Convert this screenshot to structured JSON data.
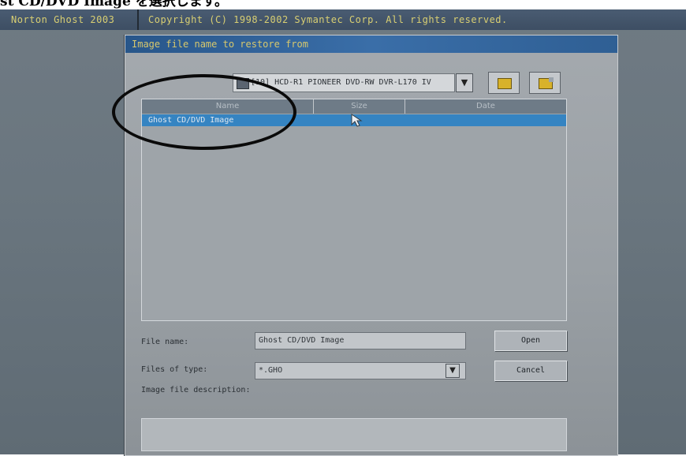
{
  "caption": "st CD/DVD Image を選択します。",
  "ghost": {
    "product": "Norton Ghost 2003",
    "copyright": "Copyright (C) 1998-2002 Symantec Corp. All rights reserved."
  },
  "dialog": {
    "title": "Image file name to restore from",
    "drive": "[10] HCD-R1 PIONEER DVD-RW DVR-L170 IV",
    "columns": [
      "Name",
      "Size",
      "Date"
    ],
    "rows": [
      {
        "name": "Ghost CD/DVD Image",
        "size": "",
        "date": ""
      }
    ],
    "file_name_label": "File name:",
    "file_name_value": "Ghost CD/DVD Image",
    "files_of_type_label": "Files of type:",
    "files_of_type_value": "*.GHO",
    "description_label": "Image file description:",
    "description_value": "",
    "open_button": "Open",
    "cancel_button": "Cancel"
  },
  "icons": {
    "dropdown": "▼"
  },
  "colors": {
    "selection": "#3584c2",
    "title_text": "#d8c86c"
  }
}
